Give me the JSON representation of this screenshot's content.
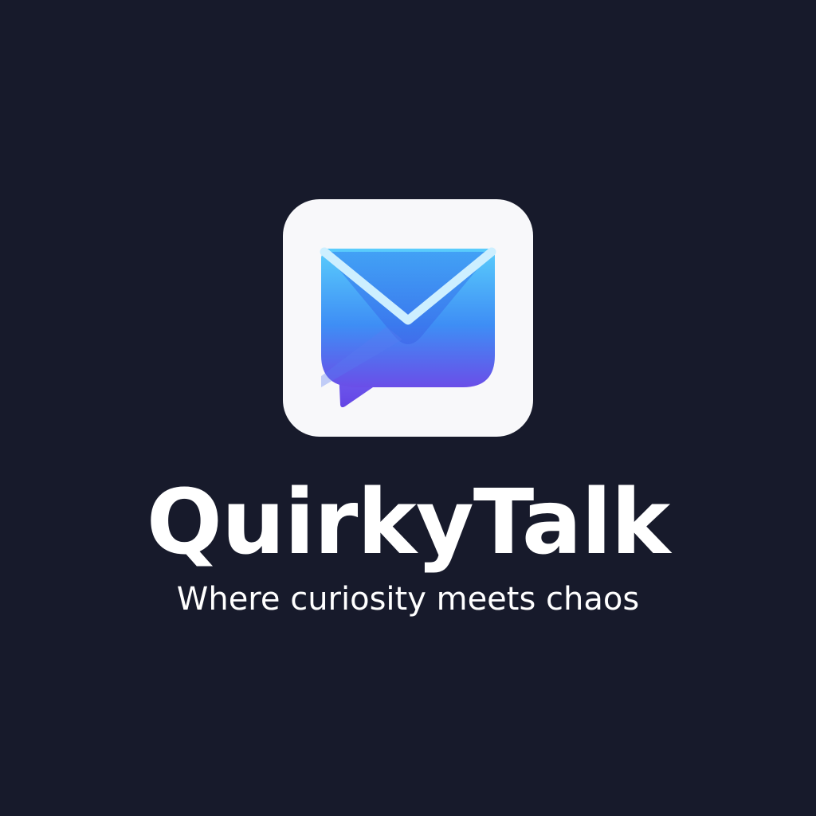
{
  "app": {
    "name": "QuirkyTalk",
    "tagline": "Where curiosity meets chaos"
  },
  "icon": {
    "name": "mail-chat-bubble-icon",
    "tile_color": "#f8f8fa"
  },
  "colors": {
    "background": "#171a2b",
    "text": "#ffffff",
    "accent_light": "#5acdfc",
    "accent_mid": "#3e8ef5",
    "accent_dark": "#6a4ee8"
  }
}
